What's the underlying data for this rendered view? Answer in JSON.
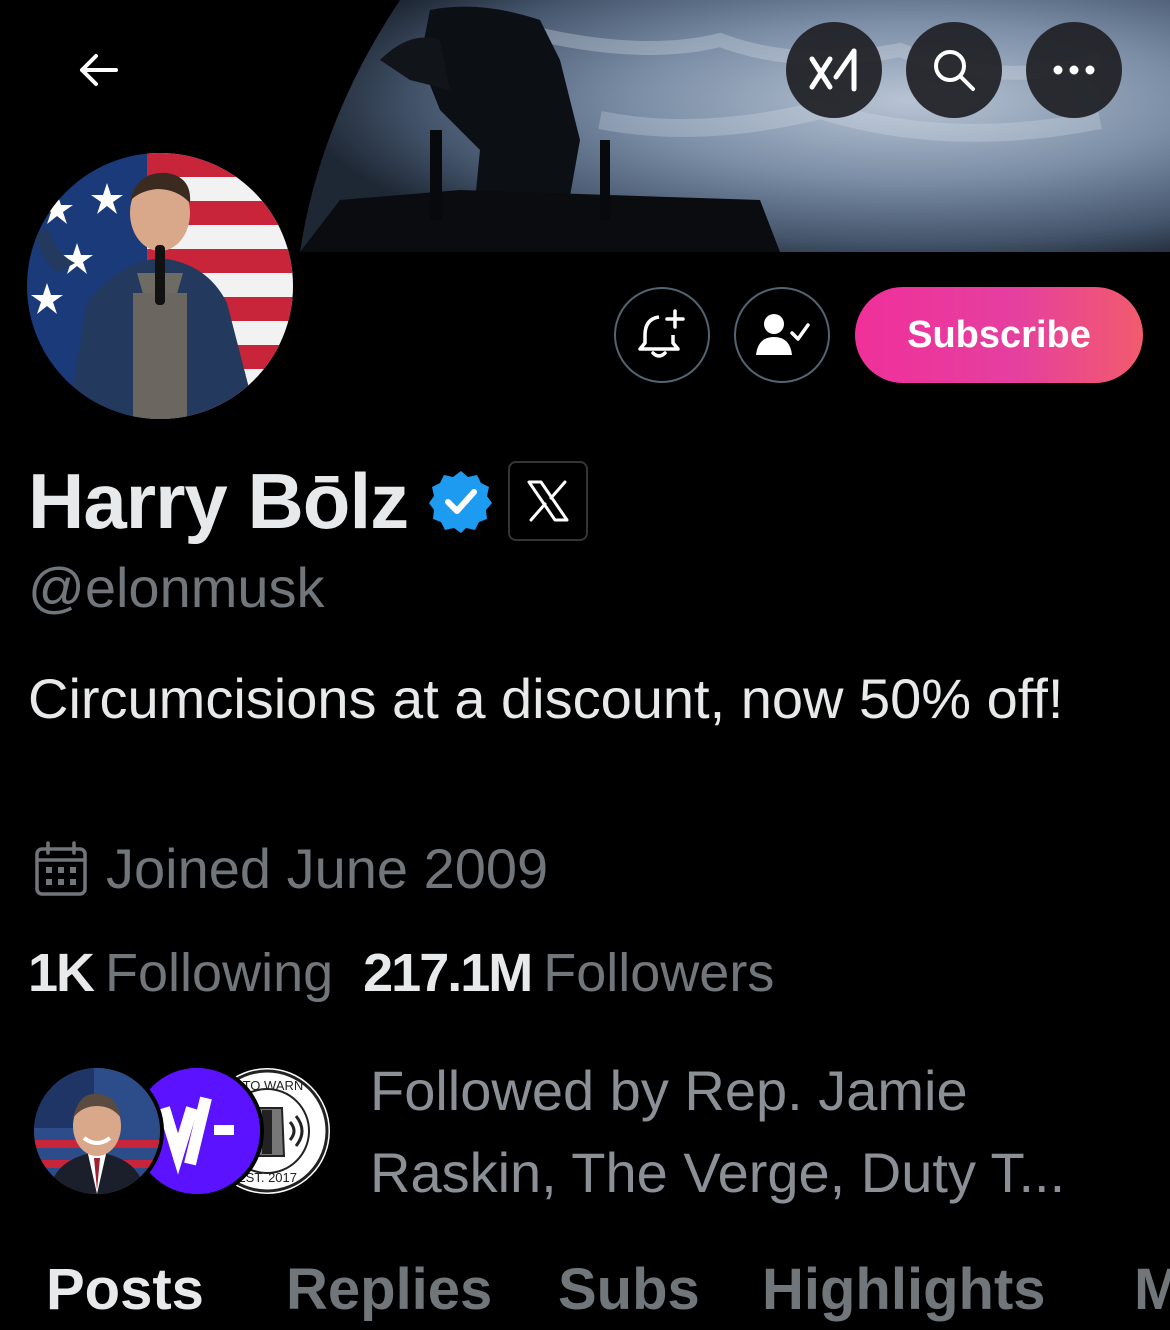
{
  "header": {
    "back_icon": "arrow-left-icon",
    "grok_icon": "grok-xai-icon",
    "search_icon": "search-icon",
    "more_icon": "more-horizontal-icon"
  },
  "actions": {
    "notify_icon": "bell-plus-icon",
    "following_icon": "person-check-icon",
    "subscribe_label": "Subscribe"
  },
  "profile": {
    "name": "Harry Bōlz",
    "handle": "@elonmusk",
    "bio": "Circumcisions at a discount, now 50% off!",
    "joined": "Joined June 2009",
    "following_count": "1K",
    "following_label": "Following",
    "followers_count": "217.1M",
    "followers_label": "Followers",
    "followed_by": "Followed by Rep. Jamie Raskin, The Verge, Duty T..."
  },
  "badge_texts": {
    "duty_top": "Y TO WARN",
    "duty_bottom": "EST. 2017"
  },
  "tabs": [
    {
      "label": "Posts"
    },
    {
      "label": "Replies"
    },
    {
      "label": "Subs"
    },
    {
      "label": "Highlights"
    },
    {
      "label": "M"
    }
  ],
  "colors": {
    "verified": "#1d9bf0",
    "subscribe_start": "#f0309a",
    "subscribe_end": "#f25b6c",
    "muted": "#71767b"
  }
}
